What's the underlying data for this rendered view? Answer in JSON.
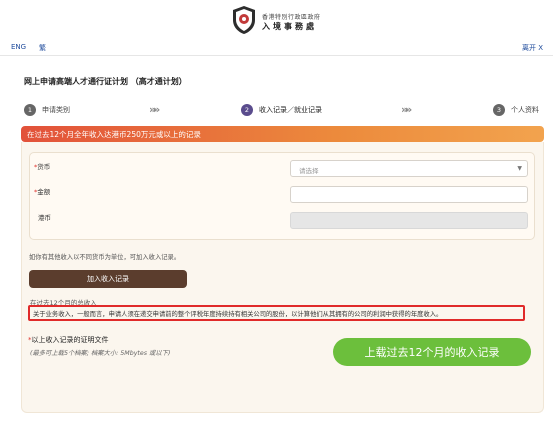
{
  "header": {
    "department_line1": "香港特別行政區政府",
    "department_name": "入境事務處"
  },
  "lang_bar": {
    "eng": "ENG",
    "trad": "繁",
    "leave": "离开 X"
  },
  "form": {
    "title": "网上申请高端人才通行证计划 （高才通计划）"
  },
  "steps": [
    {
      "num": "1",
      "label": "申请类别"
    },
    {
      "num": "2",
      "label": "收入记录／就业记录"
    },
    {
      "num": "3",
      "label": "个人资料"
    }
  ],
  "chevron": "»»",
  "banner": {
    "text": "在过去12个月全年收入达港币250万元或以上的记录"
  },
  "fields": {
    "currency_label": "货币",
    "currency_placeholder": "请选择",
    "amount_label": "金额",
    "hkd_label": "港币",
    "required_mark": "*"
  },
  "multi_note": "如你有其他收入以不同货币为单位，可加入收入记录。",
  "add_button": "加入收入记录",
  "total": {
    "title": "在过去12个月的总收入",
    "highlight": "关于业务收入，一般而言，申请人须在递交申请前的整个评税年度持续持有相关公司的股份，以计算他们从其拥有的公司的利润中获得的年度收入。"
  },
  "docs": {
    "title": "以上收入记录的证明文件",
    "note": "(最多可上载5个档案; 档案大小: 5Mbytes 或以下)"
  },
  "upload_button": "上载过去12个月的收入记录",
  "colors": {
    "banner_start": "#e2513a",
    "banner_end": "#f2a34e",
    "add_button": "#5b3d2d",
    "upload_button": "#6cbf3c",
    "highlight_border": "#e02a2a",
    "link": "#1f4b9c"
  }
}
